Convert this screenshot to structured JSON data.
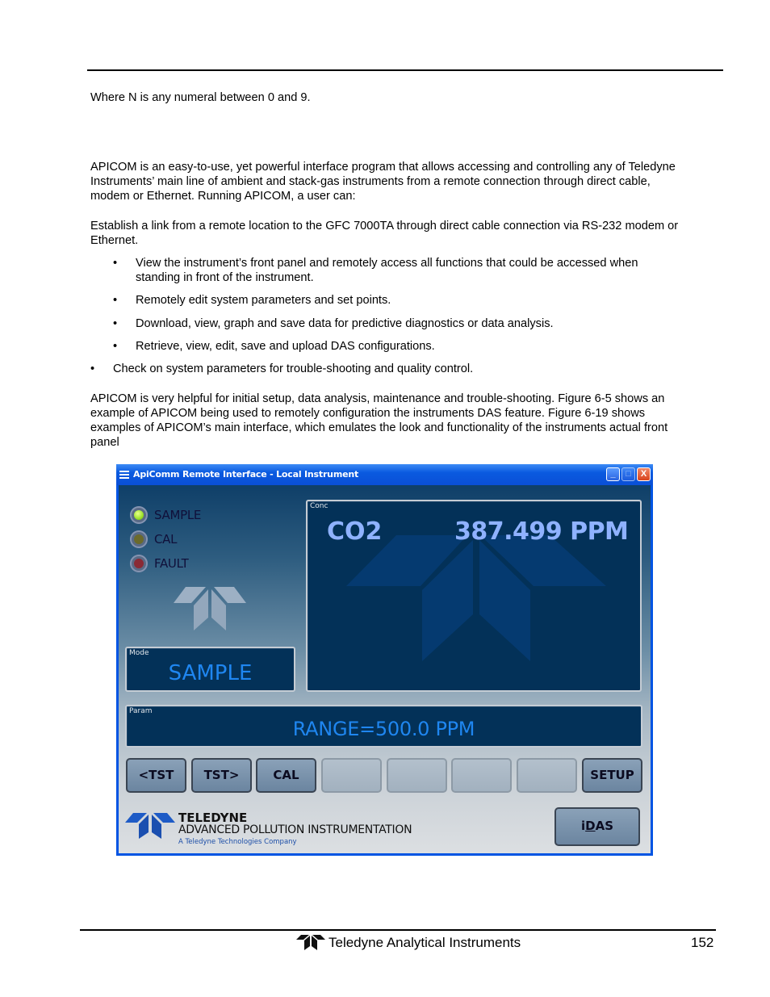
{
  "document": {
    "intro_line": "Where N is any numeral between 0 and 9.",
    "paragraph_1": "APICOM is an easy-to-use, yet powerful interface program that allows accessing and controlling any of Teledyne Instruments’ main line of ambient and stack-gas instruments from a remote connection through direct cable, modem or Ethernet.  Running APICOM, a user can:",
    "paragraph_2": "Establish a link from a remote location to the GFC 7000TA through direct cable connection via RS-232 modem or Ethernet.",
    "bullets": [
      "View the instrument’s front panel and remotely access all functions that could be accessed when standing in front of the instrument.",
      "Remotely edit system parameters and set points.",
      "Download, view, graph and save data for predictive diagnostics or data analysis.",
      "Retrieve, view, edit, save and upload DAS configurations.",
      "Check on system parameters for trouble-shooting and quality control."
    ],
    "bullet_glyph": "•",
    "paragraph_3": "APICOM is very helpful for initial setup, data analysis, maintenance and trouble-shooting.  Figure 6-5 shows an example of APICOM being used to remotely configuration the instruments DAS feature.  Figure 6-19 shows examples of APICOM’s main interface, which emulates the look and functionality of the instruments actual front panel"
  },
  "window": {
    "title": "ApiComm Remote Interface - Local Instrument",
    "controls": {
      "minimize": "_",
      "maximize": "□",
      "close": "X"
    },
    "status_leds": [
      {
        "label": "SAMPLE",
        "state": "on",
        "color": "#9be12a"
      },
      {
        "label": "CAL",
        "state": "off",
        "color": "#6b6a2c"
      },
      {
        "label": "FAULT",
        "state": "off",
        "color": "#8a2a35"
      }
    ],
    "conc_panel": {
      "label": "Conc",
      "gas": "CO2",
      "value": "387.499 PPM"
    },
    "mode_panel": {
      "label": "Mode",
      "value": "SAMPLE"
    },
    "param_panel": {
      "label": "Param",
      "value": "RANGE=500.0 PPM"
    },
    "keys": [
      "<TST",
      "TST>",
      "CAL",
      "",
      "",
      "",
      "",
      "SETUP"
    ],
    "brand": {
      "name": "TELEDYNE",
      "division": "ADVANCED POLLUTION INSTRUMENTATION",
      "tagline": "A Teledyne Technologies Company"
    },
    "idas_button": {
      "prefix": "i",
      "underlined": "D",
      "suffix": "AS"
    }
  },
  "footer": {
    "company": "Teledyne Analytical Instruments",
    "page_number": "152"
  }
}
